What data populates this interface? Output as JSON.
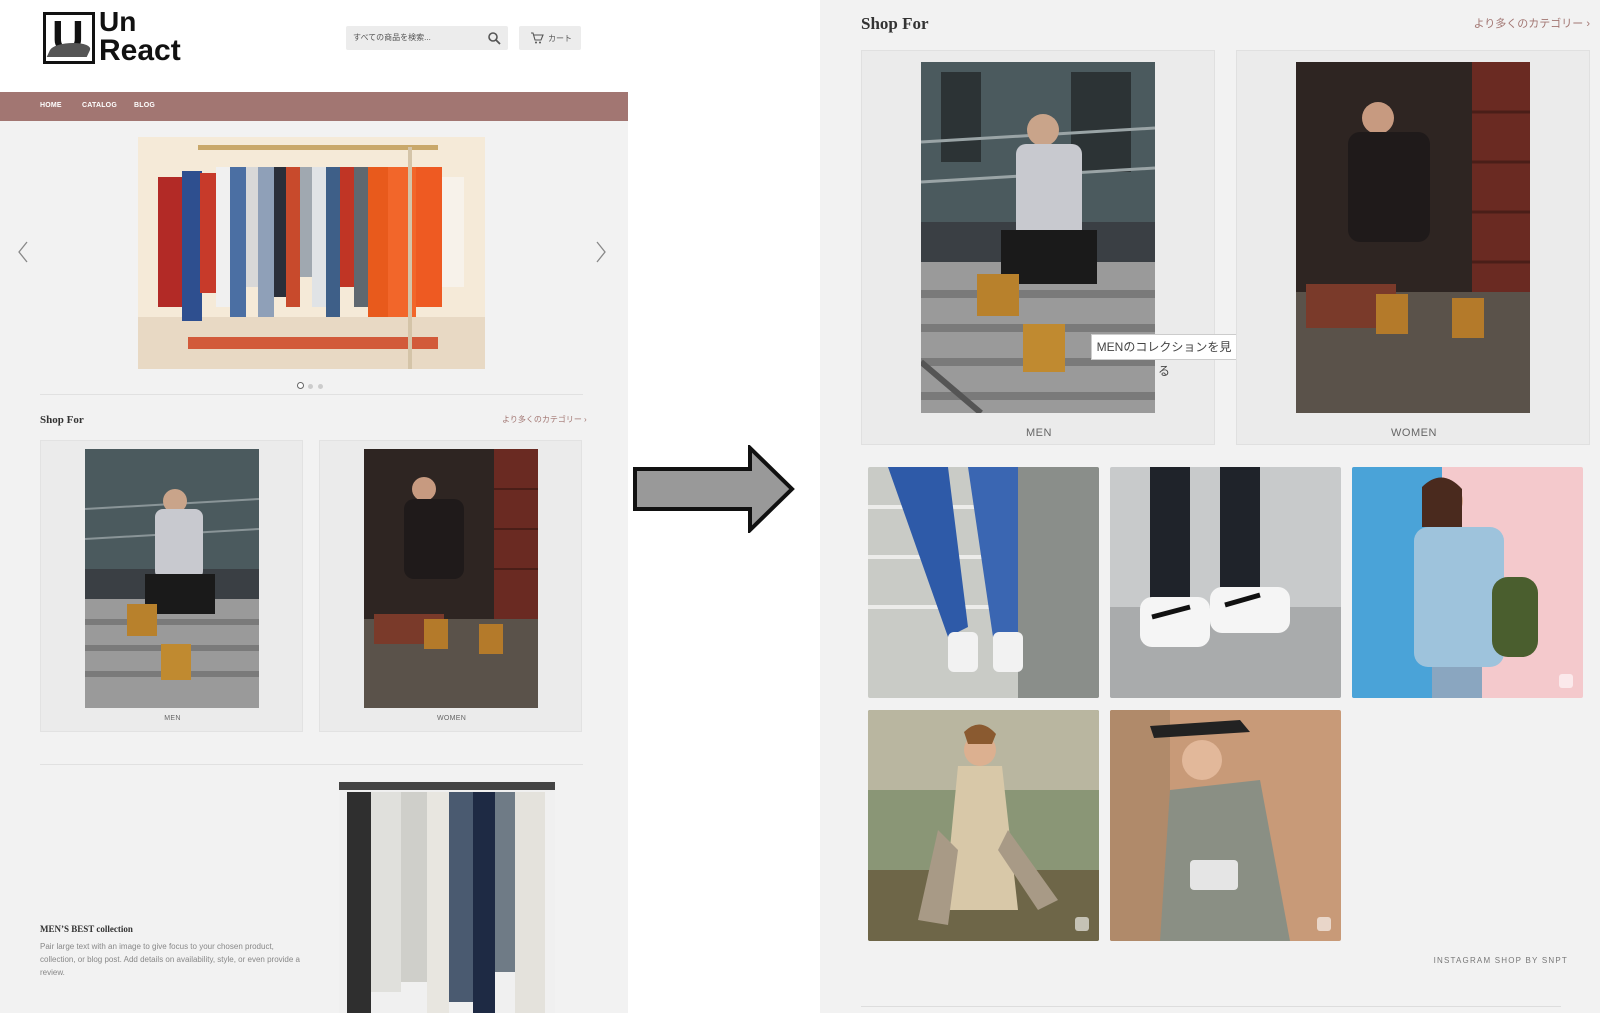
{
  "left": {
    "logo": {
      "line1": "Un",
      "line2": "React",
      "mark": "U"
    },
    "search": {
      "placeholder": "すべての商品を検索...",
      "icon": "search-icon"
    },
    "cart": {
      "label": "カート",
      "icon": "cart-icon"
    },
    "nav": [
      {
        "label": "HOME"
      },
      {
        "label": "CATALOG"
      },
      {
        "label": "BLOG"
      }
    ],
    "carousel": {
      "slides": 3,
      "active_slide": 1
    },
    "shop_for": {
      "title": "Shop For",
      "more": "より多くのカテゴリー ›",
      "categories": [
        {
          "label": "MEN"
        },
        {
          "label": "WOMEN"
        }
      ]
    },
    "feature": {
      "title": "MEN’S BEST collection",
      "body": "Pair large text with an image to give focus to your chosen product, collection, or blog post. Add details on availability, style, or even provide a review."
    }
  },
  "right": {
    "shop_for": {
      "title": "Shop For",
      "more": "より多くのカテゴリー ›",
      "categories": [
        {
          "label": "MEN"
        },
        {
          "label": "WOMEN"
        }
      ],
      "tooltip": "MENのコレクションを見る"
    },
    "instagram_footer": "INSTAGRAM SHOP BY SNPT"
  },
  "colors": {
    "nav_bg": "#a27672",
    "accent_link": "#a27672",
    "panel_bg": "#f2f2f2",
    "arrow_fill": "#999999"
  }
}
